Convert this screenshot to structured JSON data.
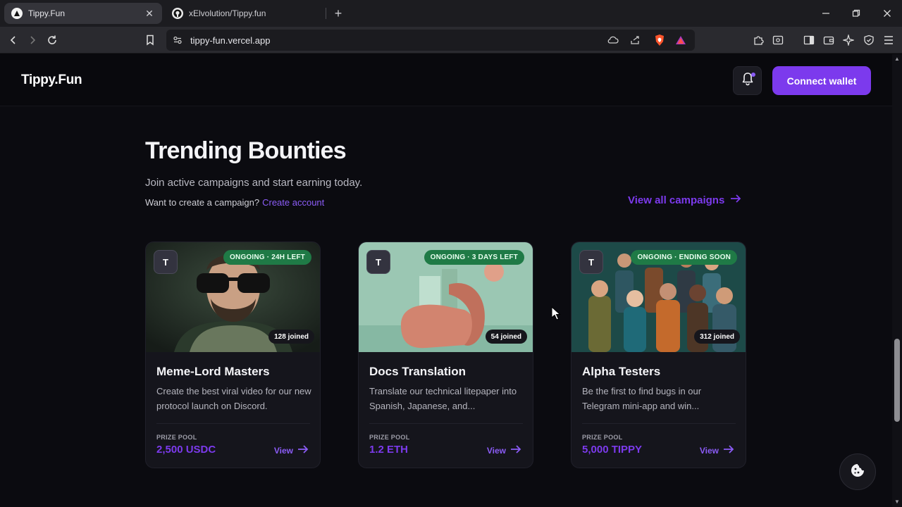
{
  "browser": {
    "tabs": [
      {
        "title": "Tippy.Fun",
        "active": true
      },
      {
        "title": "xElvolution/Tippy.fun",
        "active": false
      }
    ],
    "url": "tippy-fun.vercel.app"
  },
  "site": {
    "logo": "Tippy.Fun",
    "connect_label": "Connect wallet"
  },
  "section": {
    "title": "Trending Bounties",
    "subtitle": "Join active campaigns and start earning today.",
    "create_prompt": "Want to create a campaign?",
    "create_link": "Create account",
    "view_all": "View all campaigns"
  },
  "cards": [
    {
      "avatar": "T",
      "status": "ONGOING · 24H LEFT",
      "joined": "128 joined",
      "title": "Meme-Lord Masters",
      "description": "Create the best viral video for our new protocol launch on Discord.",
      "pool_label": "PRIZE POOL",
      "pool_value": "2,500 USDC",
      "view_label": "View"
    },
    {
      "avatar": "T",
      "status": "ONGOING · 3 DAYS LEFT",
      "joined": "54 joined",
      "title": "Docs Translation",
      "description": "Translate our technical litepaper into Spanish, Japanese, and...",
      "pool_label": "PRIZE POOL",
      "pool_value": "1.2 ETH",
      "view_label": "View"
    },
    {
      "avatar": "T",
      "status": "ONGOING · ENDING SOON",
      "joined": "312 joined",
      "title": "Alpha Testers",
      "description": "Be the first to find bugs in our Telegram mini-app and win...",
      "pool_label": "PRIZE POOL",
      "pool_value": "5,000 TIPPY",
      "view_label": "View"
    }
  ],
  "colors": {
    "accent": "#7c3aed",
    "status_green": "#1f7a46",
    "background": "#0b0b10"
  }
}
